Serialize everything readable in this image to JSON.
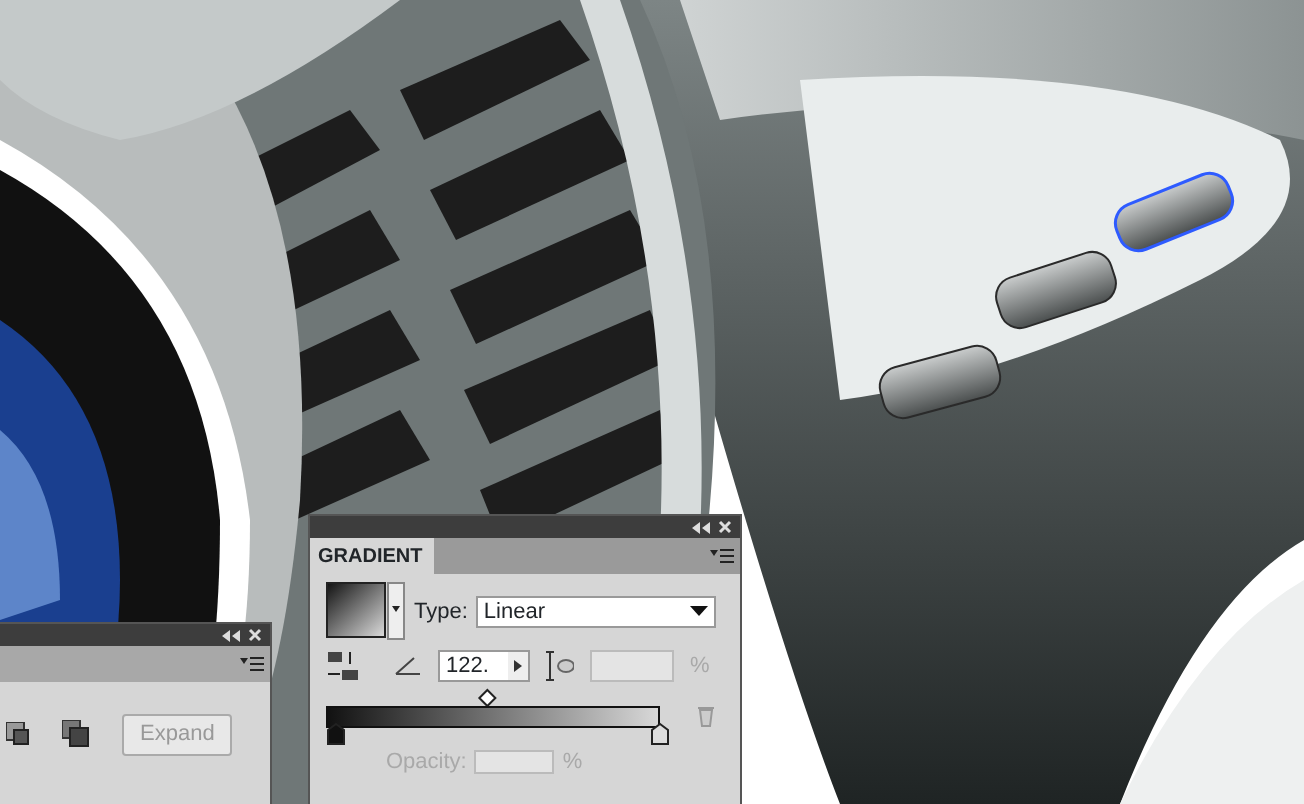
{
  "gradient_panel": {
    "title": "GRADIENT",
    "type_label": "Type:",
    "type_value": "Linear",
    "angle_value": "122.",
    "aspect_unit": "%",
    "opacity_label": "Opacity:",
    "opacity_unit": "%",
    "opacity_disabled": true,
    "midpoint": {
      "level": 0.48
    }
  },
  "left_panel": {
    "expand_button": "Expand",
    "expand_disabled": true
  }
}
